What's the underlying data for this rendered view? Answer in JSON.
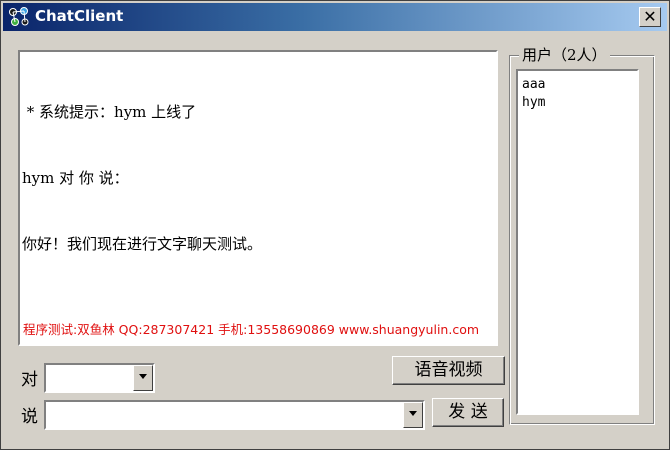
{
  "window": {
    "title": "ChatClient",
    "close_symbol": "✕"
  },
  "chat": {
    "lines": [
      " * 系统提示：hym 上线了",
      "hym 对 你 说：",
      "你好！我们现在进行文字聊天测试。"
    ],
    "footer_note": "程序测试:双鱼林 QQ:287307421 手机:13558690869 www.shuangyulin.com"
  },
  "users": {
    "legend": "用户（2人）",
    "list": [
      "aaa",
      "hym"
    ]
  },
  "controls": {
    "to_label": "对",
    "to_value": "",
    "say_label": "说",
    "say_value": "",
    "voice_video_button": "语音视频",
    "send_button": "发 送"
  },
  "icons": {
    "app": "people-network-icon",
    "close": "close-icon",
    "dropdown": "chevron-down-icon"
  },
  "colors": {
    "title_gradient_start": "#0a246a",
    "title_gradient_end": "#a6caf0",
    "footer_note": "#e01010",
    "face": "#d4d0c8"
  }
}
